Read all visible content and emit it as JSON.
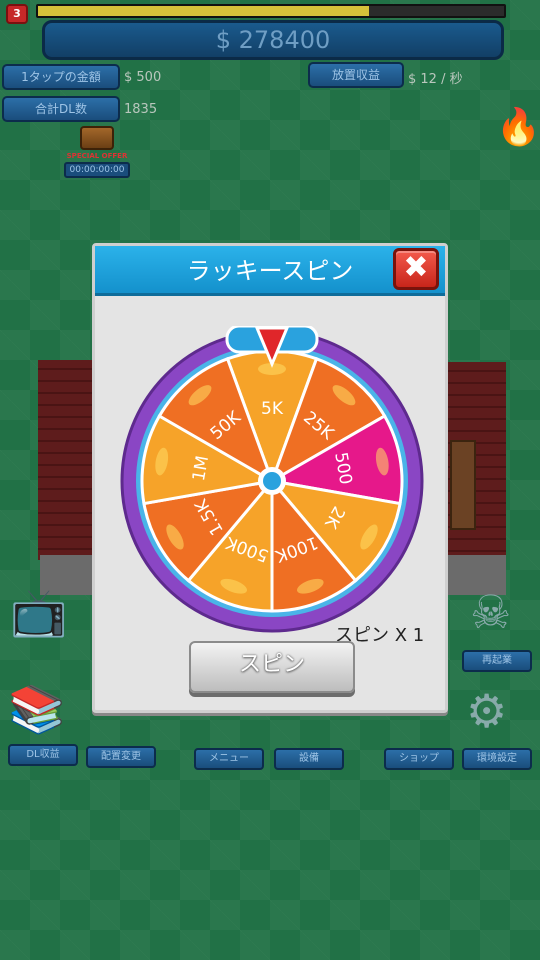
{
  "hud": {
    "level": "3",
    "xp_progress": 0.71,
    "money": "$ 278400",
    "tap_amount_label": "1タップの金額",
    "tap_amount_value": "$ 500",
    "idle_income_label": "放置収益",
    "idle_income_value": "$ 12 / 秒",
    "total_dl_label": "合計DL数",
    "total_dl_value": "1835",
    "offer_label": "SPECIAL OFFER",
    "offer_timer": "00:00:00:00"
  },
  "bottom_menu": {
    "dl_income": "DL収益",
    "layout_change": "配置変更",
    "menu": "メニュー",
    "equipment": "設備",
    "shop": "ショップ",
    "settings": "環境設定",
    "restart": "再起業"
  },
  "dialog": {
    "title": "ラッキースピン",
    "spin_count": "スピン X 1",
    "spin_button": "スピン"
  },
  "chart_data": {
    "type": "pie",
    "segments": [
      "5K",
      "25K",
      "500",
      "2K",
      "100K",
      "500K",
      "1.5K",
      "1M",
      "50K"
    ],
    "colors": [
      "#f6a329",
      "#ef6f23",
      "#e6188a",
      "#f6a329",
      "#ef6f23",
      "#f6a329",
      "#ef6f23",
      "#f6a329",
      "#ef6f23"
    ]
  },
  "colors": {
    "header_blue": "#1491cc",
    "wheel_rim": "#8a46c4",
    "close_red": "#d8322a"
  }
}
